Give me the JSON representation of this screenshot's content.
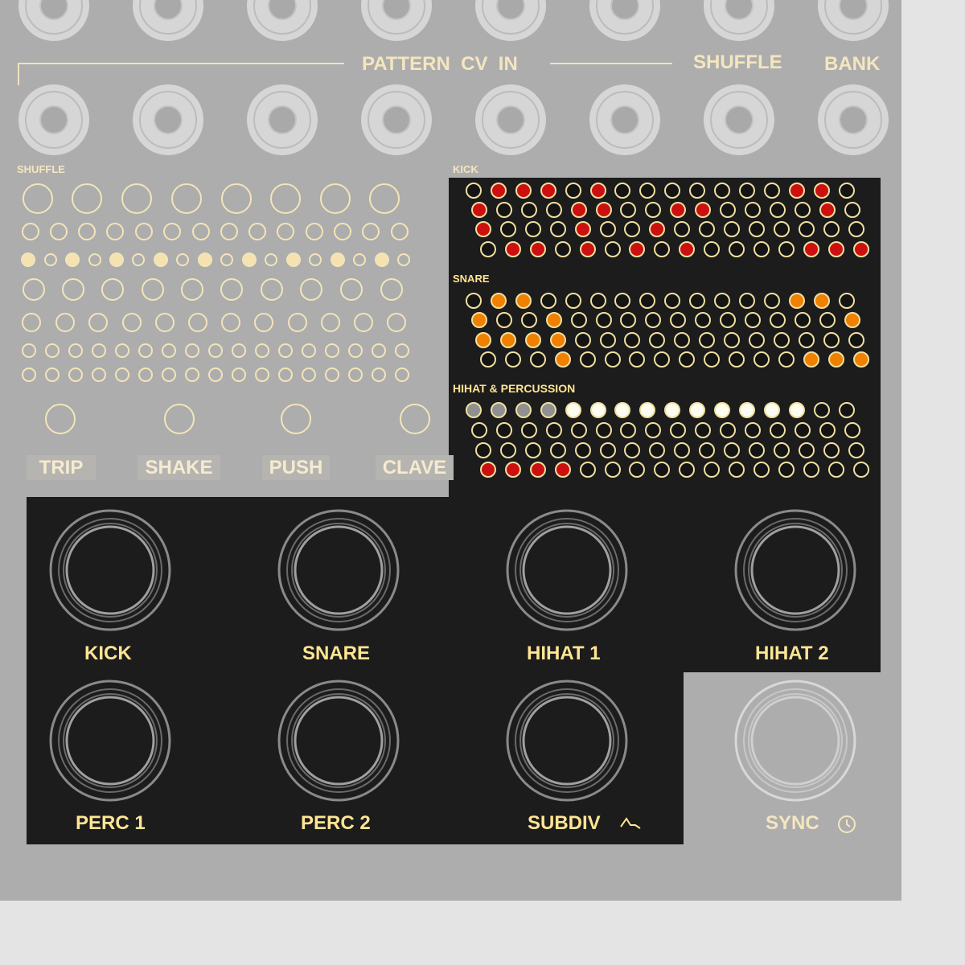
{
  "labels": {
    "pattern_cv_in": "PATTERN  CV  IN",
    "shuffle_header": "SHUFFLE",
    "bank": "BANK",
    "shuffle_small": "SHUFFLE",
    "kick_section": "KICK",
    "snare_section": "SNARE",
    "hihat_section": "HIHAT & PERCUSSION"
  },
  "shuffle_buttons": [
    "TRIP",
    "SHAKE",
    "PUSH",
    "CLAVE"
  ],
  "outputs": {
    "kick": "KICK",
    "snare": "SNARE",
    "hihat1": "HIHAT 1",
    "hihat2": "HIHAT 2",
    "perc1": "PERC 1",
    "perc2": "PERC 2",
    "subdiv": "SUBDIV",
    "sync": "SYNC"
  },
  "icons": {
    "subdiv": "envelope-icon",
    "sync": "clock-icon"
  },
  "colors": {
    "panel": "#adadad",
    "dark_panel": "#1c1c1c",
    "label_cream": "#f4e6bf",
    "label_gold": "#ffe593",
    "led_ring": "#f0dfa0",
    "kick_on": "#cc1010",
    "snare_on": "#f08000",
    "hihat_on": "#fcfcf0",
    "hihat_dim": "#909090"
  },
  "sequencer": {
    "kick": [
      "0111010000000110",
      "1000110011000010",
      "1000100100000000",
      "0110101010000111"
    ],
    "snare": [
      "0110000000000110",
      "1001000000000001",
      "1111000000000000",
      "0001000000000111"
    ],
    "hihat": [
      "2222111111111100",
      "0000000000000000",
      "0000000000000000",
      "1111000000000000"
    ]
  }
}
